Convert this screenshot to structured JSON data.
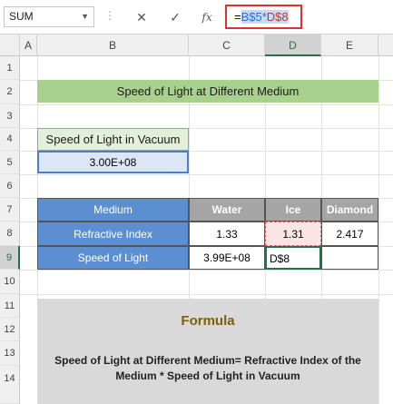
{
  "formula_bar": {
    "name_box": "SUM",
    "cancel_icon": "✕",
    "enter_icon": "✓",
    "fx_label": "fx",
    "formula_eq": "=",
    "formula_ref1": "B$5",
    "formula_op": "*",
    "formula_ref2": "D$8"
  },
  "columns": [
    "A",
    "B",
    "C",
    "D",
    "E"
  ],
  "rows": [
    "1",
    "2",
    "3",
    "4",
    "5",
    "6",
    "7",
    "8",
    "9",
    "10",
    "11",
    "12",
    "13",
    "14"
  ],
  "title": "Speed of Light at Different Medium",
  "vacuum": {
    "label": "Speed of Light in Vacuum",
    "value": "3.00E+08"
  },
  "table": {
    "headers": [
      "Medium",
      "Water",
      "Ice",
      "Diamond"
    ],
    "row1": {
      "label": "Refractive Index",
      "water": "1.33",
      "ice": "1.31",
      "diamond": "2.417"
    },
    "row2": {
      "label": "Speed of Light",
      "water": "3.99E+08",
      "ice_edit": "D$8",
      "diamond": ""
    }
  },
  "formula_box": {
    "heading": "Formula",
    "text": "Speed of Light at Different Medium= Refractive Index of the Medium * Speed of Light in Vacuum"
  }
}
